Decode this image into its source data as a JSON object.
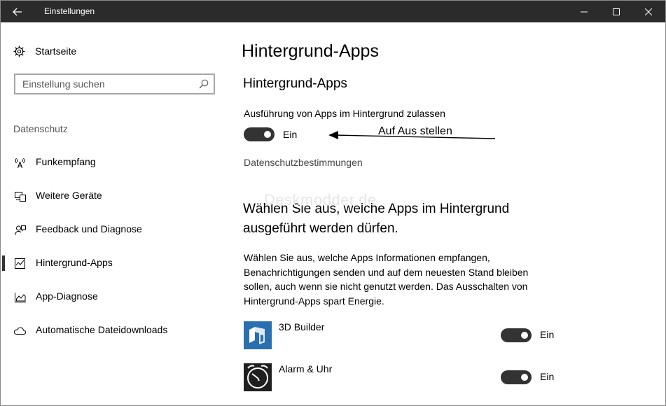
{
  "window": {
    "title": "Einstellungen"
  },
  "sidebar": {
    "home_label": "Startseite",
    "search_placeholder": "Einstellung suchen",
    "section_title": "Datenschutz",
    "items": [
      {
        "label": "Funkempfang",
        "icon": "radio-tower-icon"
      },
      {
        "label": "Weitere Geräte",
        "icon": "devices-icon"
      },
      {
        "label": "Feedback und Diagnose",
        "icon": "feedback-icon"
      },
      {
        "label": "Hintergrund-Apps",
        "icon": "background-apps-icon",
        "active": true
      },
      {
        "label": "App-Diagnose",
        "icon": "app-diagnostics-icon"
      },
      {
        "label": "Automatische Dateidownloads",
        "icon": "cloud-icon"
      }
    ]
  },
  "main": {
    "page_title": "Hintergrund-Apps",
    "section_title": "Hintergrund-Apps",
    "allow_label": "Ausführung von Apps im Hintergrund zulassen",
    "allow_state": "Ein",
    "privacy_link": "Datenschutzbestimmungen",
    "choose_title": "Wählen Sie aus, welche Apps im Hintergrund ausgeführt werden dürfen.",
    "choose_desc": "Wählen Sie aus, welche Apps Informationen empfangen, Benachrichtigungen senden und auf dem neuesten Stand bleiben sollen, auch wenn sie nicht genutzt werden. Das Ausschalten von Hintergrund-Apps spart Energie.",
    "apps": [
      {
        "name": "3D Builder",
        "state": "Ein",
        "icon": "3d-builder-icon"
      },
      {
        "name": "Alarm & Uhr",
        "state": "Ein",
        "icon": "alarm-clock-icon"
      }
    ]
  },
  "annotation": {
    "text": "Auf Aus stellen"
  },
  "watermark": {
    "text": "Deskmodder.de"
  },
  "colors": {
    "titlebar": "#2b2b2b",
    "toggle_on": "#333333",
    "app_tile_blue": "#2a6fb0",
    "app_tile_dark": "#1f1f1f"
  }
}
